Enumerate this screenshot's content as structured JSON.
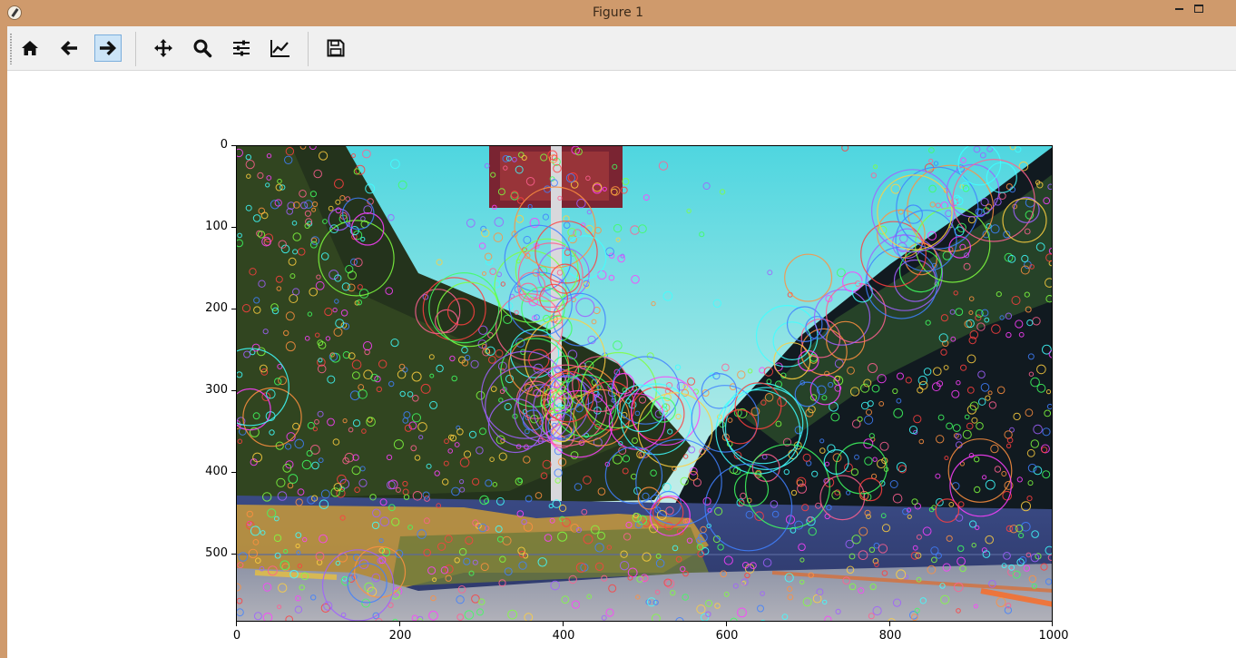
{
  "window": {
    "title": "Figure 1",
    "min_label": "—",
    "max_label": "□"
  },
  "toolbar": {
    "buttons": [
      {
        "name": "home-button",
        "icon": "home-icon",
        "active": false
      },
      {
        "name": "back-button",
        "icon": "arrow-left-icon",
        "active": false
      },
      {
        "name": "forward-button",
        "icon": "arrow-right-icon",
        "active": true
      },
      {
        "name": "pan-button",
        "icon": "move-icon",
        "active": false
      },
      {
        "name": "zoom-button",
        "icon": "magnifier-icon",
        "active": false
      },
      {
        "name": "configure-subplots-button",
        "icon": "sliders-icon",
        "active": false
      },
      {
        "name": "edit-axis-button",
        "icon": "line-chart-icon",
        "active": false
      },
      {
        "name": "save-button",
        "icon": "floppy-disk-icon",
        "active": false
      }
    ]
  },
  "plot": {
    "x_ticks": [
      "0",
      "200",
      "400",
      "600",
      "800",
      "1000"
    ],
    "y_ticks": [
      "0",
      "100",
      "200",
      "300",
      "400",
      "500"
    ],
    "image_description_colors": {
      "sky": "#6fd7e0",
      "foliage": "#1e2a18",
      "road": "#3a4470",
      "pavement": "#9aa0b0"
    }
  }
}
